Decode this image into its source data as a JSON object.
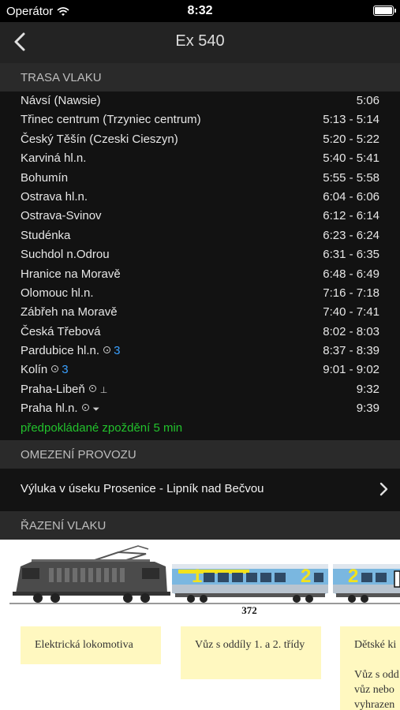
{
  "status_bar": {
    "carrier": "Operátor",
    "time": "8:32"
  },
  "nav": {
    "title": "Ex 540"
  },
  "sections": {
    "route": "TRASA VLAKU",
    "restrictions": "OMEZENÍ PROVOZU",
    "composition": "ŘAZENÍ VLAKU"
  },
  "route": [
    {
      "station": "Návsí (Nawsie)",
      "time": "5:06"
    },
    {
      "station": "Třinec centrum (Trzyniec centrum)",
      "time": "5:13 - 5:14"
    },
    {
      "station": "Český Těšín (Czeski Cieszyn)",
      "time": "5:20 - 5:22"
    },
    {
      "station": "Karviná hl.n.",
      "time": "5:40 - 5:41"
    },
    {
      "station": "Bohumín",
      "time": "5:55 - 5:58"
    },
    {
      "station": "Ostrava hl.n.",
      "time": "6:04 - 6:06"
    },
    {
      "station": "Ostrava-Svinov",
      "time": "6:12 - 6:14"
    },
    {
      "station": "Studénka",
      "time": "6:23 - 6:24"
    },
    {
      "station": "Suchdol n.Odrou",
      "time": "6:31 - 6:35"
    },
    {
      "station": "Hranice na Moravě",
      "time": "6:48 - 6:49"
    },
    {
      "station": "Olomouc hl.n.",
      "time": "7:16 - 7:18"
    },
    {
      "station": "Zábřeh na Moravě",
      "time": "7:40 - 7:41"
    },
    {
      "station": "Česká Třebová",
      "time": "8:02 - 8:03"
    },
    {
      "station": "Pardubice hl.n.",
      "platform": "3",
      "time": "8:37 - 8:39"
    },
    {
      "station": "Kolín",
      "platform": "3",
      "time": "9:01 - 9:02"
    },
    {
      "station": "Praha-Libeň",
      "glyph": "⊥",
      "time": "9:32"
    },
    {
      "station": "Praha hl.n.",
      "glyph": "⏷",
      "time": "9:39"
    }
  ],
  "delay": "předpokládané zpoždění 5 min",
  "restriction": {
    "text": "Výluka v úseku Prosenice - Lipník nad Bečvou"
  },
  "composition": {
    "car_number": "372",
    "car1_class": "1",
    "car1_class2": "2",
    "car2_class": "2",
    "notes": [
      "Elektrická lokomotiva",
      "Vůz s oddíly 1. a 2. třídy",
      "Dětské ki",
      "Vůz s odd",
      "vůz nebo",
      "vyhrazen"
    ]
  },
  "colors": {
    "accent_blue": "#3aa0ff",
    "delay_green": "#22c22c",
    "car_blue": "#7ab7e0",
    "car_stripe_yellow": "#f2e21c",
    "note_yellow": "#fff8c0"
  },
  "icons": [
    "wifi-icon",
    "battery-icon",
    "back-chevron-icon",
    "chevron-right-icon",
    "station-stop-icon",
    "terminus-icon"
  ]
}
